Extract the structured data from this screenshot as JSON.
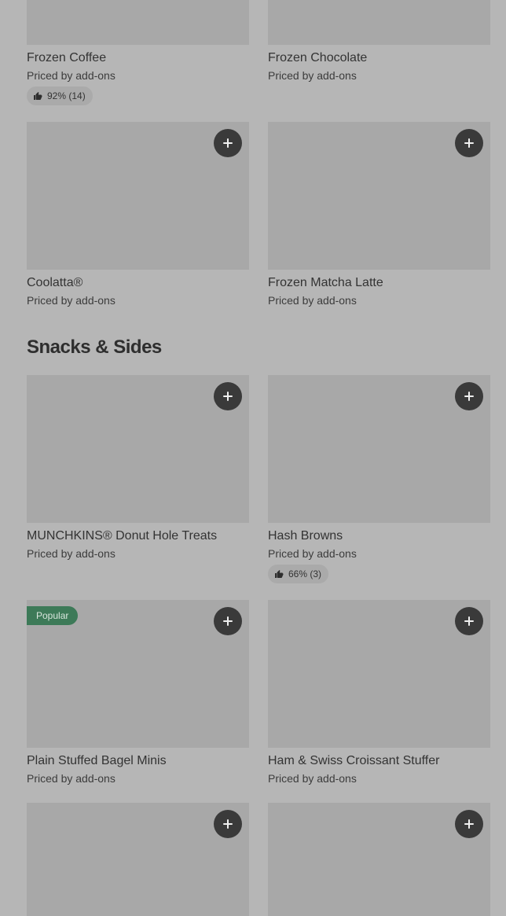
{
  "add_icon": "plus-icon",
  "rating_icon": "thumbs-up-icon",
  "colors": {
    "background": "#b6b6b6",
    "image_placeholder": "#a8a8a8",
    "add_button": "#3a3a3a",
    "popular_badge": "#3d7a58"
  },
  "items_top": [
    {
      "name": "Frozen Coffee",
      "price": "Priced by add-ons",
      "rating": "92% (14)"
    },
    {
      "name": "Frozen Chocolate",
      "price": "Priced by add-ons"
    },
    {
      "name": "Coolatta®",
      "price": "Priced by add-ons"
    },
    {
      "name": "Frozen Matcha Latte",
      "price": "Priced by add-ons"
    }
  ],
  "snacks": {
    "title": "Snacks & Sides",
    "items": [
      {
        "name": "MUNCHKINS® Donut Hole Treats",
        "price": "Priced by add-ons"
      },
      {
        "name": "Hash Browns",
        "price": "Priced by add-ons",
        "rating": "66% (3)"
      },
      {
        "name": "Plain Stuffed Bagel Minis",
        "price": "Priced by add-ons",
        "badge": "Popular"
      },
      {
        "name": "Ham & Swiss Croissant Stuffer",
        "price": "Priced by add-ons"
      }
    ]
  }
}
